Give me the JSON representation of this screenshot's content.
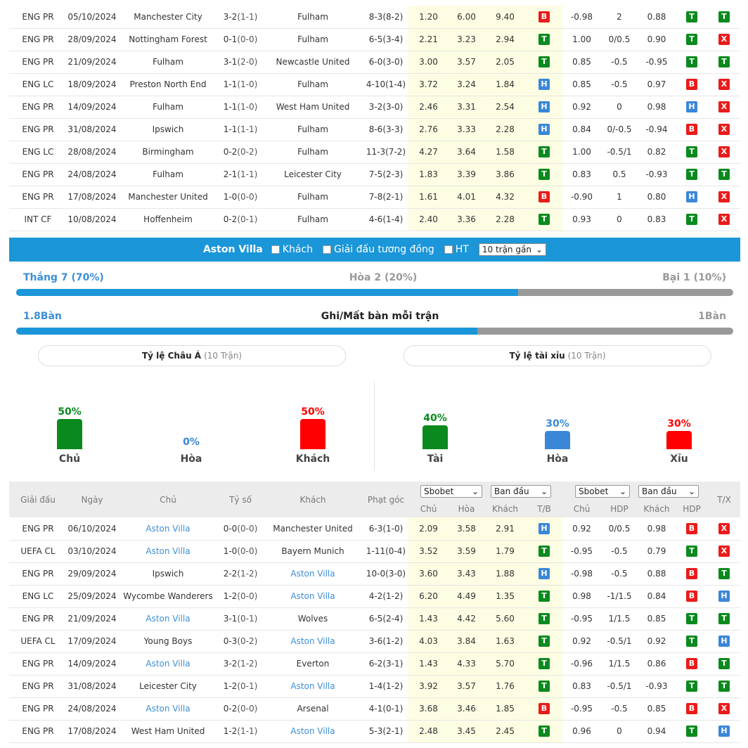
{
  "top_matches": [
    {
      "league": "ENG PR",
      "date": "05/10/2024",
      "home": "Manchester City",
      "score": "3-2",
      "ht": "(1-1)",
      "away": "Fulham",
      "corners": "8-3(8-2)",
      "o1": "1.20",
      "ox": "6.00",
      "o2": "9.40",
      "r1": "B",
      "h1": "-0.98",
      "hdp": "2",
      "h2": "0.88",
      "r2": "T",
      "r3": "T",
      "hl": "away"
    },
    {
      "league": "ENG PR",
      "date": "28/09/2024",
      "home": "Nottingham Forest",
      "score": "0-1",
      "ht": "(0-0)",
      "away": "Fulham",
      "corners": "6-5(3-4)",
      "o1": "2.21",
      "ox": "3.23",
      "o2": "2.94",
      "r1": "T",
      "h1": "1.00",
      "hdp": "0/0.5",
      "h2": "0.90",
      "r2": "T",
      "r3": "X",
      "hl": "away"
    },
    {
      "league": "ENG PR",
      "date": "21/09/2024",
      "home": "Fulham",
      "score": "3-1",
      "ht": "(2-0)",
      "away": "Newcastle United",
      "corners": "6-0(3-0)",
      "o1": "3.00",
      "ox": "3.57",
      "o2": "2.05",
      "r1": "T",
      "h1": "0.85",
      "hdp": "-0.5",
      "h2": "-0.95",
      "r2": "T",
      "r3": "T",
      "hl": "home"
    },
    {
      "league": "ENG LC",
      "date": "18/09/2024",
      "home": "Preston North End",
      "score": "1-1",
      "ht": "(1-0)",
      "away": "Fulham",
      "corners": "4-10(1-4)",
      "o1": "3.72",
      "ox": "3.24",
      "o2": "1.84",
      "r1": "H",
      "h1": "0.85",
      "hdp": "-0.5",
      "h2": "0.97",
      "r2": "B",
      "r3": "X",
      "hl": "away"
    },
    {
      "league": "ENG PR",
      "date": "14/09/2024",
      "home": "Fulham",
      "score": "1-1",
      "ht": "(1-0)",
      "away": "West Ham United",
      "corners": "3-2(3-0)",
      "o1": "2.46",
      "ox": "3.31",
      "o2": "2.54",
      "r1": "H",
      "h1": "0.92",
      "hdp": "0",
      "h2": "0.98",
      "r2": "H",
      "r3": "X",
      "hl": "home"
    },
    {
      "league": "ENG PR",
      "date": "31/08/2024",
      "home": "Ipswich",
      "score": "1-1",
      "ht": "(1-1)",
      "away": "Fulham",
      "corners": "8-6(3-3)",
      "o1": "2.76",
      "ox": "3.33",
      "o2": "2.28",
      "r1": "H",
      "h1": "0.84",
      "hdp": "0/-0.5",
      "h2": "-0.94",
      "r2": "B",
      "r3": "X",
      "hl": "away"
    },
    {
      "league": "ENG LC",
      "date": "28/08/2024",
      "home": "Birmingham",
      "score": "0-2",
      "ht": "(0-2)",
      "away": "Fulham",
      "corners": "11-3(7-2)",
      "o1": "4.27",
      "ox": "3.64",
      "o2": "1.58",
      "r1": "T",
      "h1": "1.00",
      "hdp": "-0.5/1",
      "h2": "0.82",
      "r2": "T",
      "r3": "X",
      "hl": "away"
    },
    {
      "league": "ENG PR",
      "date": "24/08/2024",
      "home": "Fulham",
      "score": "2-1",
      "ht": "(1-1)",
      "away": "Leicester City",
      "corners": "7-5(2-3)",
      "o1": "1.83",
      "ox": "3.39",
      "o2": "3.86",
      "r1": "T",
      "h1": "0.83",
      "hdp": "0.5",
      "h2": "-0.93",
      "r2": "T",
      "r3": "T",
      "hl": "home"
    },
    {
      "league": "ENG PR",
      "date": "17/08/2024",
      "home": "Manchester United",
      "score": "1-0",
      "ht": "(0-0)",
      "away": "Fulham",
      "corners": "7-8(2-1)",
      "o1": "1.61",
      "ox": "4.01",
      "o2": "4.32",
      "r1": "B",
      "h1": "-0.90",
      "hdp": "1",
      "h2": "0.80",
      "r2": "H",
      "r3": "X",
      "hl": "away"
    },
    {
      "league": "INT CF",
      "date": "10/08/2024",
      "home": "Hoffenheim",
      "score": "0-2",
      "ht": "(0-1)",
      "away": "Fulham",
      "corners": "4-6(1-4)",
      "o1": "2.40",
      "ox": "3.36",
      "o2": "2.28",
      "r1": "T",
      "h1": "0.93",
      "hdp": "0",
      "h2": "0.83",
      "r2": "T",
      "r3": "X",
      "hl": "away"
    }
  ],
  "filter": {
    "team": "Aston Villa",
    "opt_away": "Khách",
    "opt_same_league": "Giải đấu tương đồng",
    "opt_ht": "HT",
    "select_value": "10 trận gần",
    "select_arrow": "⌄"
  },
  "summary": {
    "win": "Thắng 7 (70%)",
    "draw": "Hòa 2 (20%)",
    "loss": "Bại 1 (10%)",
    "win_fraction": 0.7
  },
  "goals": {
    "left": "1.8Bàn",
    "title": "Ghi/Mất bàn mỗi trận",
    "right": "1Bàn",
    "fraction": 0.643
  },
  "asian": {
    "label": "Tỷ lệ Châu Á",
    "sub": "(10 Trận)",
    "bars": [
      {
        "pct": "50%",
        "label": "Chủ",
        "value": 50,
        "color": "#0a8a1e"
      },
      {
        "pct": "0%",
        "label": "Hòa",
        "value": 0,
        "color": "#3a87d8"
      },
      {
        "pct": "50%",
        "label": "Khách",
        "value": 50,
        "color": "#ff0000"
      }
    ]
  },
  "ou": {
    "label": "Tỷ lệ tài xỉu",
    "sub": "(10 Trận)",
    "bars": [
      {
        "pct": "40%",
        "label": "Tài",
        "value": 40,
        "color": "#0a8a1e"
      },
      {
        "pct": "30%",
        "label": "Hòa",
        "value": 30,
        "color": "#3a87d8"
      },
      {
        "pct": "30%",
        "label": "Xỉu",
        "value": 30,
        "color": "#ff0000"
      }
    ]
  },
  "header": {
    "league": "Giải đấu",
    "date": "Ngày",
    "home": "Chủ",
    "score": "Tỷ số",
    "away": "Khách",
    "corners": "Phạt góc",
    "sel1": "Sbobet",
    "sel2": "Ban đầu",
    "sel3": "Sbobet",
    "sel4": "Ban đầu",
    "arrow": "⌄",
    "sub_home": "Chủ",
    "sub_draw": "Hòa",
    "sub_away": "Khách",
    "sub_tb": "T/B",
    "sub_home2": "Chủ",
    "sub_hdp": "HDP",
    "sub_away2": "Khách",
    "sub_hdp2": "HDP",
    "tx": "T/X"
  },
  "bottom_matches": [
    {
      "league": "ENG PR",
      "date": "06/10/2024",
      "home": "Aston Villa",
      "score": "0-0",
      "ht": "(0-0)",
      "away": "Manchester United",
      "corners": "6-3(1-0)",
      "o1": "2.09",
      "ox": "3.58",
      "o2": "2.91",
      "r1": "H",
      "h1": "0.92",
      "hdp": "0/0.5",
      "h2": "0.98",
      "r2": "B",
      "r3": "X",
      "hl": "home"
    },
    {
      "league": "UEFA CL",
      "date": "03/10/2024",
      "home": "Aston Villa",
      "score": "1-0",
      "ht": "(0-0)",
      "away": "Bayern Munich",
      "corners": "1-11(0-4)",
      "o1": "3.52",
      "ox": "3.59",
      "o2": "1.79",
      "r1": "T",
      "h1": "-0.95",
      "hdp": "-0.5",
      "h2": "0.79",
      "r2": "T",
      "r3": "X",
      "hl": "home"
    },
    {
      "league": "ENG PR",
      "date": "29/09/2024",
      "home": "Ipswich",
      "score": "2-2",
      "ht": "(1-2)",
      "away": "Aston Villa",
      "corners": "10-0(3-0)",
      "o1": "3.60",
      "ox": "3.43",
      "o2": "1.88",
      "r1": "H",
      "h1": "-0.98",
      "hdp": "-0.5",
      "h2": "0.88",
      "r2": "B",
      "r3": "T",
      "hl": "away"
    },
    {
      "league": "ENG LC",
      "date": "25/09/2024",
      "home": "Wycombe Wanderers",
      "score": "1-2",
      "ht": "(0-0)",
      "away": "Aston Villa",
      "corners": "4-2(1-2)",
      "o1": "6.20",
      "ox": "4.49",
      "o2": "1.35",
      "r1": "T",
      "h1": "0.98",
      "hdp": "-1/1.5",
      "h2": "0.84",
      "r2": "B",
      "r3": "H",
      "hl": "away"
    },
    {
      "league": "ENG PR",
      "date": "21/09/2024",
      "home": "Aston Villa",
      "score": "3-1",
      "ht": "(0-1)",
      "away": "Wolves",
      "corners": "6-5(2-4)",
      "o1": "1.43",
      "ox": "4.42",
      "o2": "5.60",
      "r1": "T",
      "h1": "-0.95",
      "hdp": "1/1.5",
      "h2": "0.85",
      "r2": "T",
      "r3": "T",
      "hl": "home"
    },
    {
      "league": "UEFA CL",
      "date": "17/09/2024",
      "home": "Young Boys",
      "score": "0-3",
      "ht": "(0-2)",
      "away": "Aston Villa",
      "corners": "3-6(1-2)",
      "o1": "4.03",
      "ox": "3.84",
      "o2": "1.63",
      "r1": "T",
      "h1": "0.92",
      "hdp": "-0.5/1",
      "h2": "0.92",
      "r2": "T",
      "r3": "H",
      "hl": "away"
    },
    {
      "league": "ENG PR",
      "date": "14/09/2024",
      "home": "Aston Villa",
      "score": "3-2",
      "ht": "(1-2)",
      "away": "Everton",
      "corners": "6-2(3-1)",
      "o1": "1.43",
      "ox": "4.33",
      "o2": "5.70",
      "r1": "T",
      "h1": "-0.96",
      "hdp": "1/1.5",
      "h2": "0.86",
      "r2": "B",
      "r3": "T",
      "hl": "home"
    },
    {
      "league": "ENG PR",
      "date": "31/08/2024",
      "home": "Leicester City",
      "score": "1-2",
      "ht": "(0-1)",
      "away": "Aston Villa",
      "corners": "1-4(1-2)",
      "o1": "3.92",
      "ox": "3.57",
      "o2": "1.76",
      "r1": "T",
      "h1": "0.83",
      "hdp": "-0.5/1",
      "h2": "-0.93",
      "r2": "T",
      "r3": "T",
      "hl": "away"
    },
    {
      "league": "ENG PR",
      "date": "24/08/2024",
      "home": "Aston Villa",
      "score": "0-2",
      "ht": "(0-0)",
      "away": "Arsenal",
      "corners": "4-1(0-1)",
      "o1": "3.68",
      "ox": "3.46",
      "o2": "1.85",
      "r1": "B",
      "h1": "-0.95",
      "hdp": "-0.5",
      "h2": "0.85",
      "r2": "B",
      "r3": "X",
      "hl": "home"
    },
    {
      "league": "ENG PR",
      "date": "17/08/2024",
      "home": "West Ham United",
      "score": "1-2",
      "ht": "(1-1)",
      "away": "Aston Villa",
      "corners": "5-3(2-1)",
      "o1": "2.48",
      "ox": "3.45",
      "o2": "2.45",
      "r1": "T",
      "h1": "0.96",
      "hdp": "0",
      "h2": "0.94",
      "r2": "T",
      "r3": "H",
      "hl": "away"
    }
  ]
}
